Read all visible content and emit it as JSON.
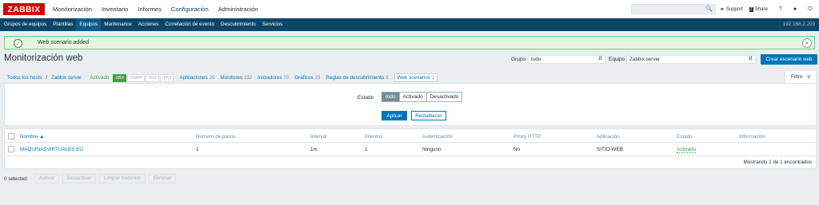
{
  "topbar": {
    "logo": "ZABBIX",
    "menu": [
      "Monitorización",
      "Inventario",
      "Informes",
      "Configuración",
      "Administración"
    ],
    "search_value": "",
    "support": "Support",
    "share": "Share",
    "help": "?"
  },
  "subbar": {
    "items": [
      "Grupos de equipos",
      "Plantillas",
      "Equipos",
      "Mantenance",
      "Acciones",
      "Correlación de evento",
      "Descubrimiento",
      "Servicios"
    ],
    "server_ip": "192.168.2.203"
  },
  "message": {
    "text": "Web scenario added"
  },
  "page": {
    "title": "Monitorización web",
    "group_label": "Grupo",
    "group_value": "todo",
    "host_label": "Equipo",
    "host_value": "Zabbix server",
    "create_button": "Crear escenario web"
  },
  "nav": {
    "all_hosts": "Todos los hosts",
    "sep": "/",
    "host": "Zabbix server",
    "enabled": "Activado",
    "tags": [
      "ZBX",
      "SNMP",
      "JMX",
      "IPMI"
    ],
    "links": [
      {
        "label": "Aplicaciones",
        "count": "20"
      },
      {
        "label": "Monitores",
        "count": "132"
      },
      {
        "label": "Iniciadores",
        "count": "70"
      },
      {
        "label": "Gráficos",
        "count": "23"
      },
      {
        "label": "Reglas de descubrimiento",
        "count": "3"
      },
      {
        "label": "Web scenarios",
        "count": "1"
      }
    ],
    "filter_tab": "Filtro"
  },
  "filter": {
    "estado_label": "Estado",
    "options": [
      "todo",
      "Activado",
      "Desactivado"
    ],
    "apply": "Aplicar",
    "reset": "Restablecer"
  },
  "table": {
    "headers": [
      "Nombre ▲",
      "Número de pasos",
      "Interval",
      "Intentos",
      "Autenticación",
      "Proxy HTTP",
      "Aplicación",
      "Estado",
      "Información"
    ],
    "rows": [
      {
        "name": "MAQUINASVIRTUALES.EU",
        "steps": "1",
        "interval": "1m",
        "attempts": "1",
        "auth": "Ninguno",
        "proxy": "No",
        "app": "SITIO-WEB",
        "status": "Activado",
        "info": ""
      }
    ],
    "footer": "Mostrando 1 de 1 encontrados"
  },
  "actions": {
    "selected": "0 selected",
    "buttons": [
      "Activar",
      "Desactivar",
      "Limpiar histórico",
      "Eliminar"
    ]
  },
  "colors": {
    "brand_red": "#d40000",
    "nav_blue": "#0a466a",
    "accent_blue": "#0275b8",
    "success_green": "#429e47"
  }
}
